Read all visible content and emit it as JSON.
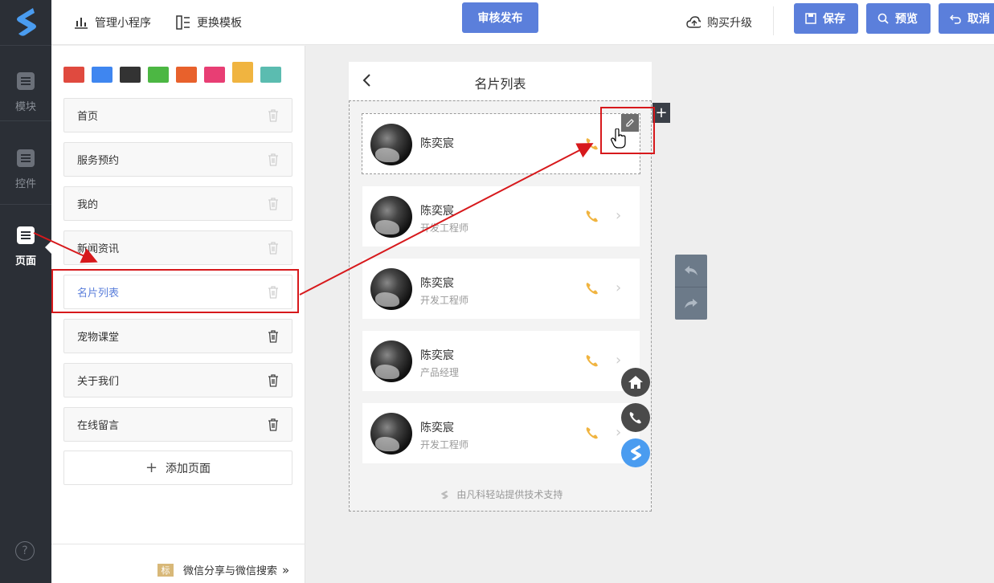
{
  "sidebar": {
    "items": [
      {
        "label": "模块",
        "icon": "module-icon"
      },
      {
        "label": "控件",
        "icon": "widget-icon"
      },
      {
        "label": "页面",
        "icon": "page-icon"
      }
    ],
    "help": "?"
  },
  "topbar": {
    "manage_label": "管理小程序",
    "template_label": "更换模板",
    "publish_label": "审核发布",
    "upgrade_label": "购买升级",
    "save_label": "保存",
    "preview_label": "预览",
    "cancel_label": "取消",
    "colors": {
      "primary": "#5b7fdb"
    }
  },
  "theme_swatches": [
    "#e04a3f",
    "#3f86f0",
    "#333333",
    "#4cb743",
    "#e8612c",
    "#e83e74",
    "#f0b440",
    "#5bbcb0"
  ],
  "pages": {
    "items": [
      {
        "label": "首页"
      },
      {
        "label": "服务预约"
      },
      {
        "label": "我的"
      },
      {
        "label": "新闻资讯"
      },
      {
        "label": "名片列表"
      },
      {
        "label": "宠物课堂"
      },
      {
        "label": "关于我们"
      },
      {
        "label": "在线留言"
      }
    ],
    "add_label": "添加页面",
    "footer_tag": "标",
    "footer_label": "微信分享与微信搜索",
    "footer_arrow": "»"
  },
  "phone": {
    "back": "‹",
    "title": "名片列表",
    "cards": [
      {
        "name": "陈奕宸",
        "role": ""
      },
      {
        "name": "陈奕宸",
        "role": "开发工程师"
      },
      {
        "name": "陈奕宸",
        "role": "开发工程师"
      },
      {
        "name": "陈奕宸",
        "role": "产品经理"
      },
      {
        "name": "陈奕宸",
        "role": "开发工程师"
      }
    ],
    "powered_by": "由凡科轻站提供技术支持"
  }
}
